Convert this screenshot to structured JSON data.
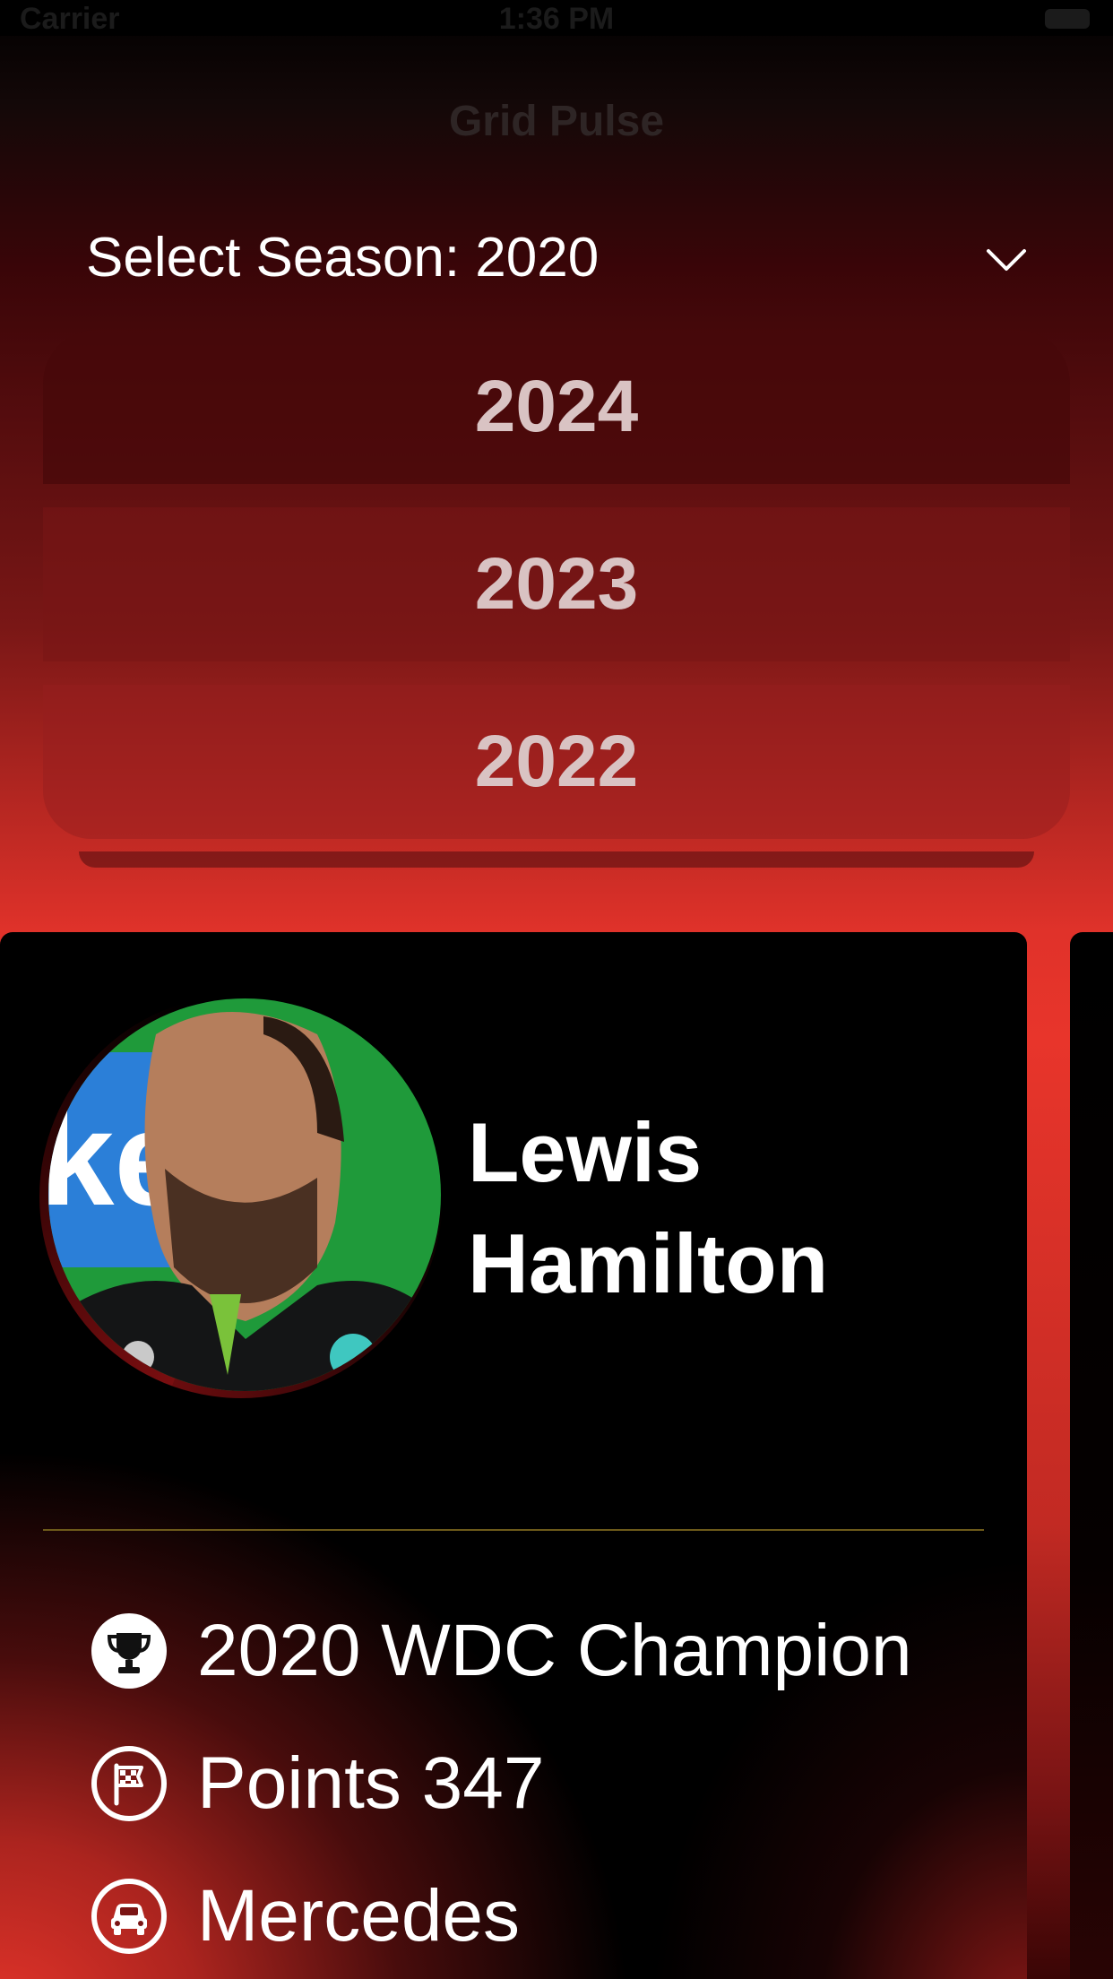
{
  "status_bar": {
    "carrier": "Carrier",
    "time": "1:36 PM"
  },
  "app": {
    "title": "Grid Pulse"
  },
  "season_selector": {
    "label": "Select Season: 2020",
    "icon": "chevron-down-icon"
  },
  "season_options": [
    "2024",
    "2023",
    "2022"
  ],
  "driver": {
    "first_name": "Lewis",
    "last_name": "Hamilton",
    "stats": [
      {
        "icon": "trophy-icon",
        "text": "2020 WDC Champion"
      },
      {
        "icon": "checkered-flag-icon",
        "text": "Points 347"
      },
      {
        "icon": "car-icon",
        "text": "Mercedes"
      }
    ]
  },
  "colors": {
    "accent_red": "#e8352b",
    "card_bg": "#000000",
    "divider": "#6d5a1a",
    "option_text": "#d9c3c3"
  }
}
